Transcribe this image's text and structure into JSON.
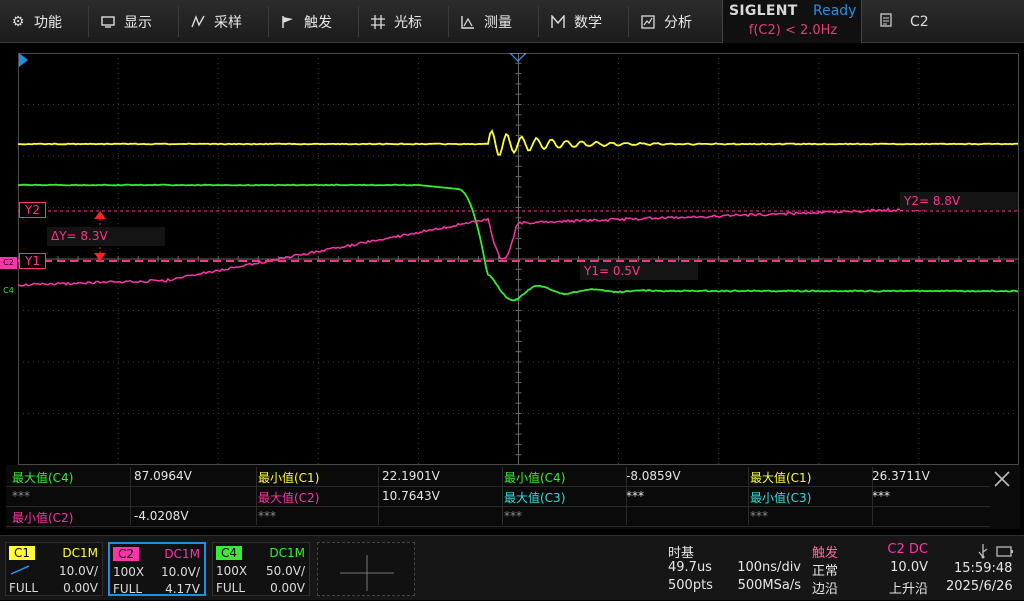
{
  "menu": {
    "items": [
      {
        "label": "功能",
        "icon": "gear-icon"
      },
      {
        "label": "显示",
        "icon": "monitor-icon"
      },
      {
        "label": "采样",
        "icon": "sampling-icon"
      },
      {
        "label": "触发",
        "icon": "flag-icon"
      },
      {
        "label": "光标",
        "icon": "cursor-grid-icon"
      },
      {
        "label": "测量",
        "icon": "measure-icon"
      },
      {
        "label": "数学",
        "icon": "math-icon"
      },
      {
        "label": "分析",
        "icon": "analysis-icon"
      }
    ]
  },
  "brand": {
    "logo": "SIGLENT",
    "status": "Ready",
    "trigger_text": "f(C2) < 2.0Hz"
  },
  "channel_select": {
    "label": "C2",
    "icon": "document-icon"
  },
  "colors": {
    "c1": "#ffff33",
    "c2": "#ff33aa",
    "c4": "#33ee33",
    "c3": "#33dddd",
    "accent": "#1e90e0",
    "grid": "#3a3a3a"
  },
  "cursors": {
    "y2_tag": "Y2",
    "y1_tag": "Y1",
    "delta": "ΔY= 8.3V",
    "y1_readout": "Y1= 0.5V",
    "y2_readout": "Y2= 8.8V",
    "c2_marker": "C2",
    "c4_marker": "C4"
  },
  "measurements": {
    "rows": [
      [
        {
          "label": "最大值(C4)",
          "value": "87.0964V",
          "color": "#33ee33"
        },
        {
          "label": "最小值(C1)",
          "value": "22.1901V",
          "color": "#ffff33"
        },
        {
          "label": "最小值(C4)",
          "value": "-8.0859V",
          "color": "#33ee33"
        },
        {
          "label": "最大值(C1)",
          "value": "26.3711V",
          "color": "#ffff33"
        }
      ],
      [
        {
          "label": "***",
          "value": "",
          "color": "#8a8a8a"
        },
        {
          "label": "最大值(C2)",
          "value": "10.7643V",
          "color": "#ff33aa"
        },
        {
          "label": "最大值(C3)",
          "value": "***",
          "color": "#33dddd"
        },
        {
          "label": "最小值(C3)",
          "value": "***",
          "color": "#33dddd"
        }
      ],
      [
        {
          "label": "最小值(C2)",
          "value": "-4.0208V",
          "color": "#ff33aa"
        },
        {
          "label": "***",
          "value": "",
          "color": "#8a8a8a"
        },
        {
          "label": "***",
          "value": "",
          "color": "#8a8a8a"
        },
        {
          "label": "***",
          "value": "",
          "color": "#8a8a8a"
        }
      ]
    ]
  },
  "channels": [
    {
      "name": "C1",
      "coupling": "DC1M",
      "probe": "",
      "scale": "10.0V/",
      "bw": "FULL",
      "offset": "0.00V",
      "color": "#ffff33"
    },
    {
      "name": "C2",
      "coupling": "DC1M",
      "probe": "100X",
      "scale": "10.0V/",
      "bw": "FULL",
      "offset": "4.17V",
      "color": "#ff33aa"
    },
    {
      "name": "C4",
      "coupling": "DC1M",
      "probe": "100X",
      "scale": "50.0V/",
      "bw": "FULL",
      "offset": "0.00V",
      "color": "#33ee33"
    }
  ],
  "timebase": {
    "title": "时基",
    "delay": "49.7us",
    "scale": "100ns/div",
    "points": "500pts",
    "rate": "500MSa/s"
  },
  "trigger": {
    "title": "触发",
    "source": "C2 DC",
    "mode": "正常",
    "level": "10.0V",
    "type": "边沿",
    "slope": "上升沿"
  },
  "clock": {
    "time": "15:59:48",
    "date": "2025/6/26"
  }
}
